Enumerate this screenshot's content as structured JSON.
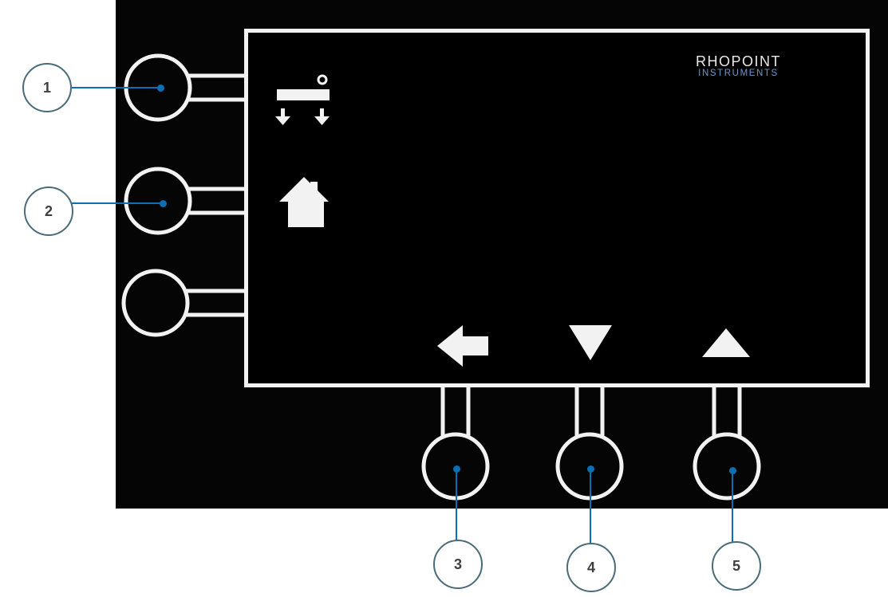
{
  "brand": {
    "line1": "RHOPOINT",
    "line2": "INSTRUMENTS"
  },
  "softkeys": {
    "left": [
      {
        "icon": "measure-calibrate-icon"
      },
      {
        "icon": "home-icon"
      },
      {
        "icon": ""
      }
    ],
    "bottom": [
      {
        "icon": "back-arrow-icon"
      },
      {
        "icon": "down-triangle-icon"
      },
      {
        "icon": "up-triangle-icon"
      }
    ]
  },
  "callouts": [
    "1",
    "2",
    "3",
    "4",
    "5"
  ],
  "colors": {
    "frame": "#f2f2f2",
    "panel": "#050505",
    "leader": "#0a6fb5",
    "callout_border": "#4a6b78",
    "brand_sub": "#6f97c9"
  }
}
